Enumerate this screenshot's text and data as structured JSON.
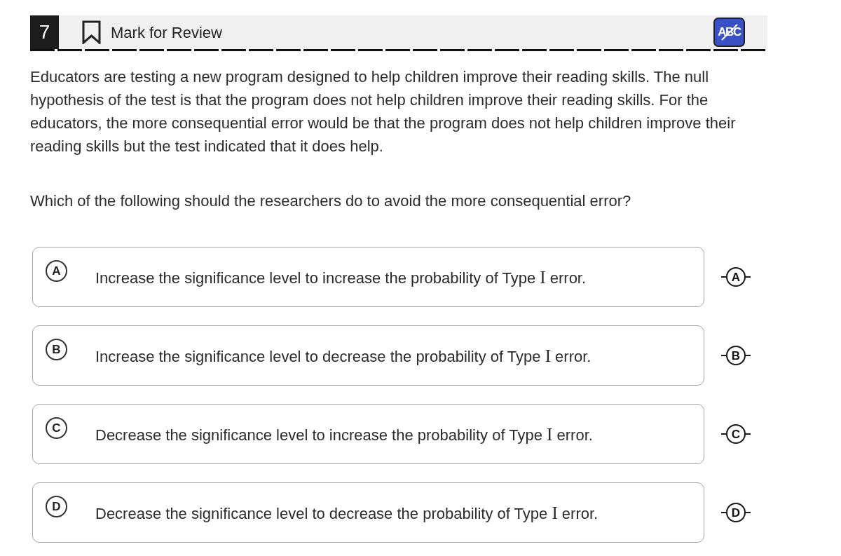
{
  "question_header": {
    "number": "7",
    "mark_for_review": {
      "label": "Mark for Review",
      "marked": false
    },
    "cross_out_tool": {
      "label": "ABC",
      "on": true
    }
  },
  "passage": "Educators are testing a new program designed to help children improve their reading skills. The null hypothesis of the test is that the program does not help children improve their reading skills. For the educators, the more consequential error would be that the program does not help children improve their reading skills but the test indicated that it does help.",
  "question": "Which of the following should the researchers do to avoid the more consequential error?",
  "choices": [
    {
      "letter": "A",
      "text": [
        {
          "kind": "plain",
          "text": "Increase the significance level to increase the probability of Type "
        },
        {
          "kind": "numeral",
          "text": "I"
        },
        {
          "kind": "plain",
          "text": " error."
        }
      ],
      "selected": false,
      "crossed_out": false,
      "cross_out_letter": "A"
    },
    {
      "letter": "B",
      "text": [
        {
          "kind": "plain",
          "text": "Increase the significance level to decrease the probability of Type "
        },
        {
          "kind": "numeral",
          "text": "I"
        },
        {
          "kind": "plain",
          "text": " error."
        }
      ],
      "selected": false,
      "crossed_out": false,
      "cross_out_letter": "B"
    },
    {
      "letter": "C",
      "text": [
        {
          "kind": "plain",
          "text": "Decrease the significance level to increase the probability of Type "
        },
        {
          "kind": "numeral",
          "text": "I"
        },
        {
          "kind": "plain",
          "text": " error."
        }
      ],
      "selected": false,
      "crossed_out": false,
      "cross_out_letter": "C"
    },
    {
      "letter": "D",
      "text": [
        {
          "kind": "plain",
          "text": "Decrease the significance level to decrease the probability of Type "
        },
        {
          "kind": "numeral",
          "text": "I"
        },
        {
          "kind": "plain",
          "text": " error."
        }
      ],
      "selected": false,
      "crossed_out": false,
      "cross_out_letter": "D"
    }
  ]
}
